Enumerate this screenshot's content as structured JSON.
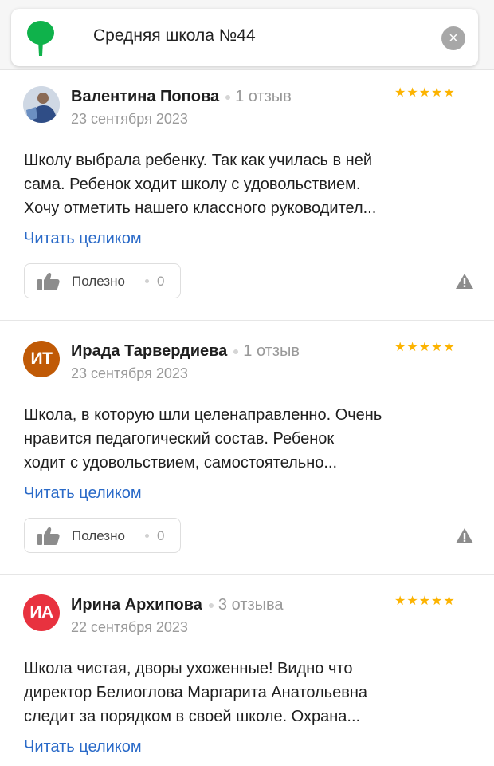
{
  "search": {
    "query": "Средняя школа №44"
  },
  "colors": {
    "accent": "#fcb300",
    "link": "#2a6ac8",
    "logo": "#0fb24b"
  },
  "reviews": [
    {
      "author": "Валентина Попова",
      "reviews_count": "1 отзыв",
      "date": "23 сентября 2023",
      "rating": 5,
      "stars": "★★★★★",
      "avatar": {
        "type": "photo",
        "initials": "",
        "color": "#3b5a8c"
      },
      "text_lines": [
        "Школу выбрала ребенку. Так как училась в ней",
        "сама. Ребенок ходит школу с удовольствием.",
        "Хочу отметить нашего классного руководител..."
      ],
      "read_more": "Читать целиком",
      "useful_label": "Полезно",
      "useful_count": "0"
    },
    {
      "author": "Ирада Тарвердиева",
      "reviews_count": "1 отзыв",
      "date": "23 сентября 2023",
      "rating": 5,
      "stars": "★★★★★",
      "avatar": {
        "type": "initials",
        "initials": "ИТ",
        "color": "#c05a06"
      },
      "text_lines": [
        "Школа, в которую шли целенаправленно. Очень",
        "нравится педагогический состав. Ребенок",
        "ходит с удовольствием, самостоятельно..."
      ],
      "read_more": "Читать целиком",
      "useful_label": "Полезно",
      "useful_count": "0"
    },
    {
      "author": "Ирина Архипова",
      "reviews_count": "3 отзыва",
      "date": "22 сентября 2023",
      "rating": 5,
      "stars": "★★★★★",
      "avatar": {
        "type": "initials",
        "initials": "ИА",
        "color": "#e8323f"
      },
      "text_lines": [
        "Школа чистая, дворы ухоженные! Видно что",
        "директор Белиоглова Маргарита Анатольевна",
        "следит за порядком в своей школе. Охрана..."
      ],
      "read_more": "Читать целиком",
      "useful_label": "Полезно",
      "useful_count": "0"
    }
  ]
}
